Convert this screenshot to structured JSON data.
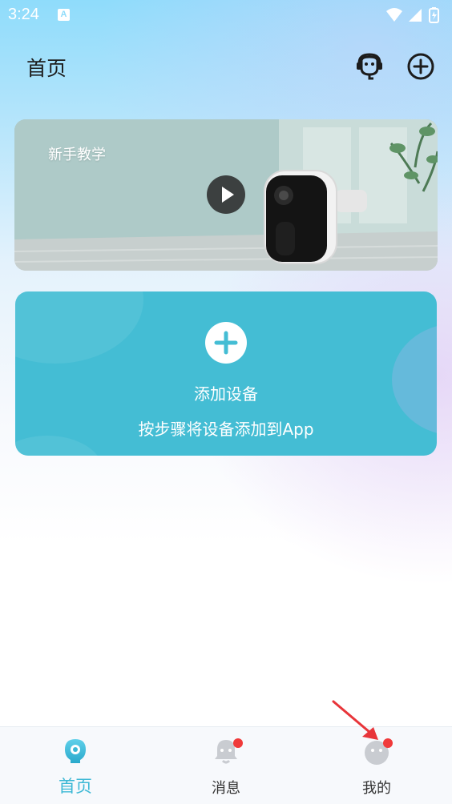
{
  "status_bar": {
    "time": "3:24",
    "notification_icon": "A",
    "icons": [
      "wifi-icon",
      "signal-icon",
      "battery-icon"
    ]
  },
  "header": {
    "title": "首页",
    "actions": [
      "headset-support-icon",
      "add-circle-icon"
    ]
  },
  "tutorial_banner": {
    "title": "新手教学",
    "play_icon": "play-icon"
  },
  "add_device_card": {
    "title": "添加设备",
    "subtitle": "按步骤将设备添加到App",
    "icon": "plus-icon"
  },
  "tab_bar": {
    "tabs": [
      {
        "label": "首页",
        "icon": "home-camera-icon",
        "active": true,
        "badge": false
      },
      {
        "label": "消息",
        "icon": "message-bell-icon",
        "active": false,
        "badge": true
      },
      {
        "label": "我的",
        "icon": "profile-face-icon",
        "active": false,
        "badge": true
      }
    ]
  },
  "colors": {
    "accent": "#3bb8d5",
    "card": "#44bdd4",
    "badge": "#f03a3a",
    "annotation_arrow": "#e8353a"
  }
}
